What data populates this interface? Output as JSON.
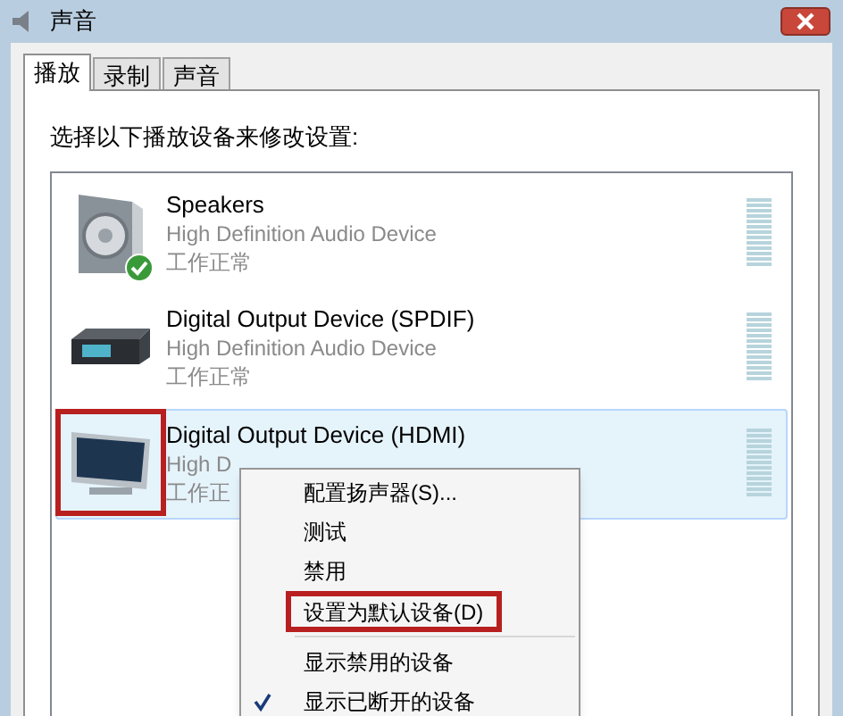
{
  "window": {
    "title": "声音"
  },
  "tabs": [
    {
      "label": "播放",
      "selected": true
    },
    {
      "label": "录制",
      "selected": false
    },
    {
      "label": "声音",
      "selected": false
    }
  ],
  "instruction": "选择以下播放设备来修改设置:",
  "devices": [
    {
      "kind": "speaker",
      "name": "Speakers",
      "description": "High Definition Audio Device",
      "status": "工作正常",
      "default": true,
      "selected": false,
      "annotated": false
    },
    {
      "kind": "receiver",
      "name": "Digital Output Device (SPDIF)",
      "description": "High Definition Audio Device",
      "status": "工作正常",
      "default": false,
      "selected": false,
      "annotated": false
    },
    {
      "kind": "monitor",
      "name": "Digital Output Device (HDMI)",
      "description": "High D",
      "status": "工作正",
      "default": false,
      "selected": true,
      "annotated": true
    }
  ],
  "context_menu": [
    {
      "kind": "item",
      "label": "配置扬声器(S)...",
      "checked": false,
      "annotated": false
    },
    {
      "kind": "item",
      "label": "测试",
      "checked": false,
      "annotated": false
    },
    {
      "kind": "item",
      "label": "禁用",
      "checked": false,
      "annotated": false
    },
    {
      "kind": "item",
      "label": "设置为默认设备(D)",
      "checked": false,
      "annotated": true
    },
    {
      "kind": "separator"
    },
    {
      "kind": "item",
      "label": "显示禁用的设备",
      "checked": false,
      "annotated": false
    },
    {
      "kind": "item",
      "label": "显示已断开的设备",
      "checked": true,
      "annotated": false
    }
  ]
}
